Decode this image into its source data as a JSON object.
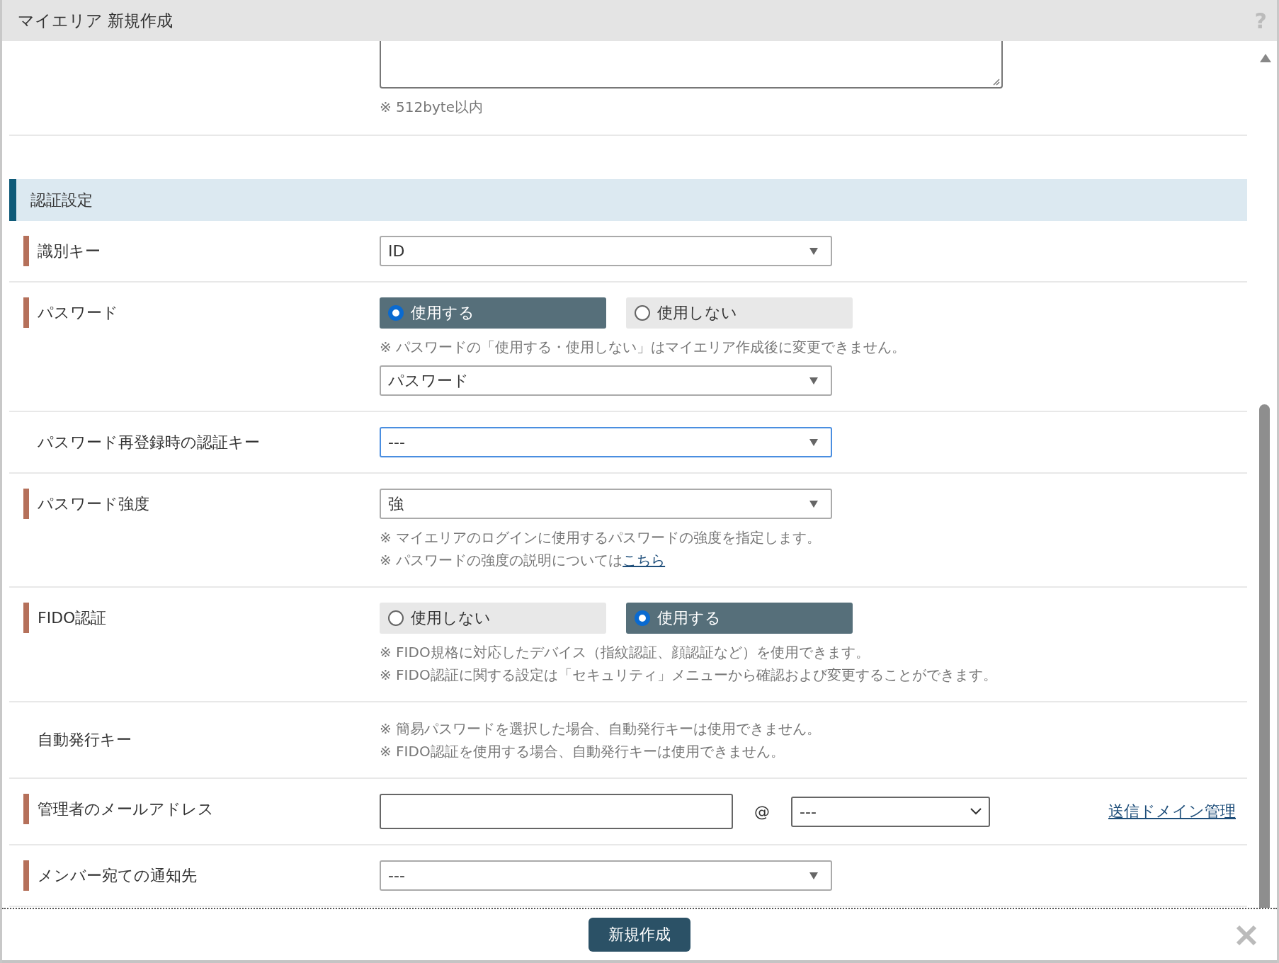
{
  "dialog": {
    "title": "マイエリア 新規作成",
    "help": "?"
  },
  "top_note": "※ 512byte以内",
  "section": {
    "title": "認証設定"
  },
  "rows": [
    {
      "kind": "select",
      "label": "識別キー",
      "required": true,
      "value": "ID",
      "focused": false
    },
    {
      "kind": "radio",
      "label": "パスワード",
      "required": true,
      "options": [
        {
          "label": "使用する",
          "selected": true
        },
        {
          "label": "使用しない",
          "selected": false
        }
      ],
      "notes": [
        {
          "text": "※ パスワードの「使用する・使用しない」はマイエリア作成後に変更できません。"
        }
      ],
      "value": "パスワード",
      "focused": false
    },
    {
      "kind": "select",
      "label": "パスワード再登録時の認証キー",
      "required": false,
      "value": "---",
      "focused": true
    },
    {
      "kind": "select",
      "label": "パスワード強度",
      "required": true,
      "value": "強",
      "focused": false,
      "notes": [
        {
          "text": "※ マイエリアのログインに使用するパスワードの強度を指定します。"
        },
        {
          "text": "※ パスワードの強度の説明については",
          "link": "こちら"
        }
      ]
    },
    {
      "kind": "radio",
      "label": "FIDO認証",
      "required": true,
      "options": [
        {
          "label": "使用しない",
          "selected": false
        },
        {
          "label": "使用する",
          "selected": true
        }
      ],
      "notes": [
        {
          "text": "※ FIDO規格に対応したデバイス（指紋認証、顔認証など）を使用できます。"
        },
        {
          "text": "※ FIDO認証に関する設定は「セキュリティ」メニューから確認および変更することができます。"
        }
      ]
    },
    {
      "kind": "notes",
      "label": "自動発行キー",
      "required": false,
      "notes": [
        {
          "text": "※ 簡易パスワードを選択した場合、自動発行キーは使用できません。"
        },
        {
          "text": "※ FIDO認証を使用する場合、自動発行キーは使用できません。"
        }
      ]
    },
    {
      "kind": "email",
      "label": "管理者のメールアドレス",
      "required": true,
      "at": "@",
      "domain": "---",
      "link": "送信ドメイン管理"
    },
    {
      "kind": "select",
      "label": "メンバー宛ての通知先",
      "required": true,
      "value": "---",
      "focused": false
    }
  ],
  "footer": {
    "submit": "新規作成"
  }
}
